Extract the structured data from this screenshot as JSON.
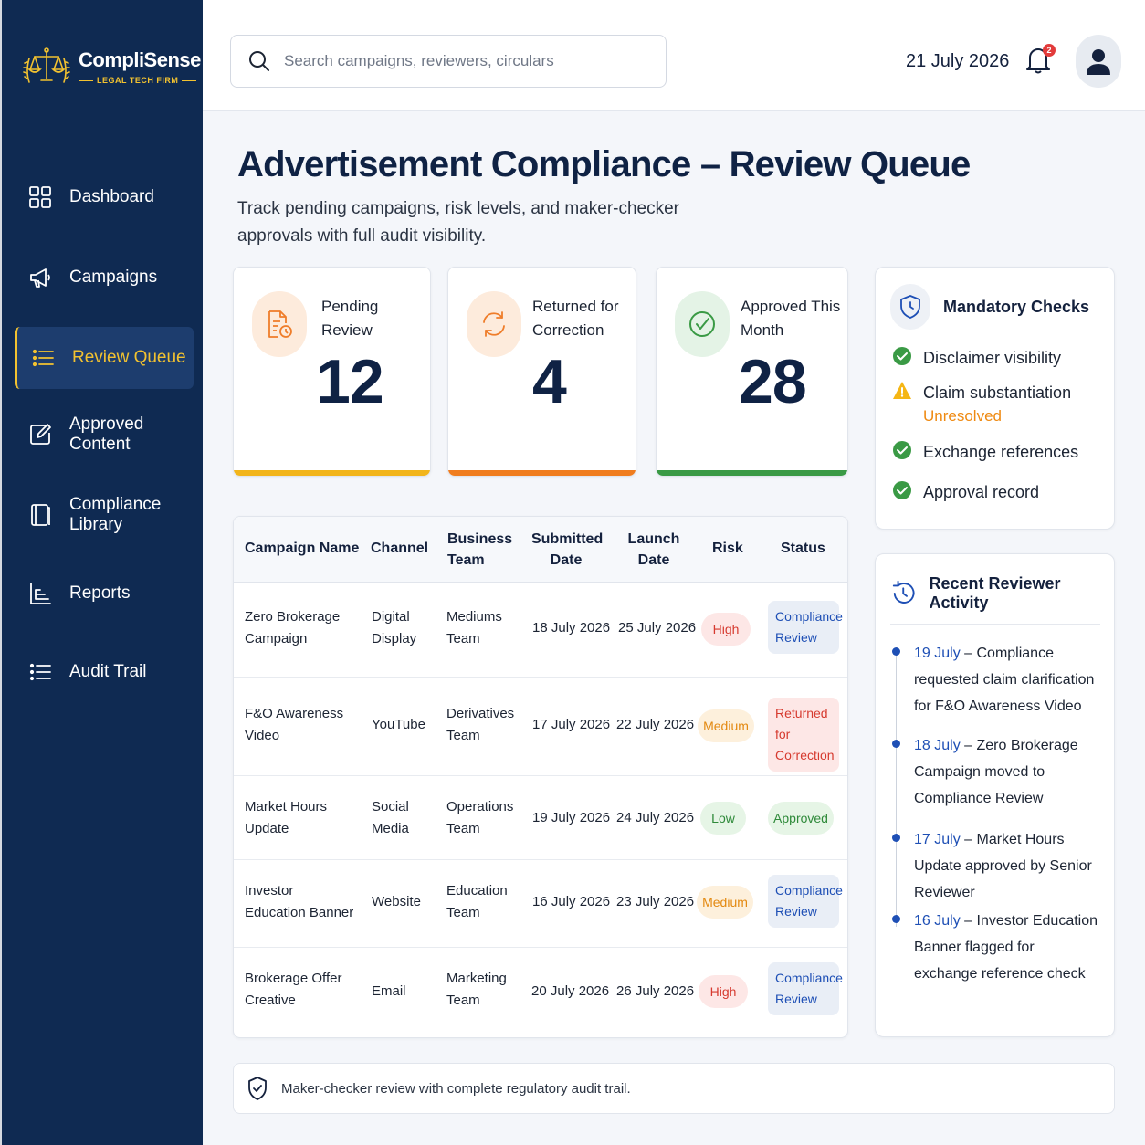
{
  "brand": {
    "name": "CompliSense",
    "tagline": "LEGAL TECH FIRM"
  },
  "sidebar": {
    "items": [
      {
        "label": "Dashboard",
        "icon": "grid-icon",
        "active": false
      },
      {
        "label": "Campaigns",
        "icon": "megaphone-icon",
        "active": false
      },
      {
        "label": "Review Queue",
        "icon": "list-icon",
        "active": true
      },
      {
        "label": "Approved Content",
        "icon": "edit-icon",
        "active": false
      },
      {
        "label": "Compliance Library",
        "icon": "book-icon",
        "active": false
      },
      {
        "label": "Reports",
        "icon": "bar-chart-icon",
        "active": false
      },
      {
        "label": "Audit Trail",
        "icon": "list-icon",
        "active": false
      }
    ]
  },
  "topbar": {
    "search_placeholder": "Search campaigns, reviewers, circulars",
    "date": "21 July 2026",
    "notification_count": "2"
  },
  "page": {
    "title": "Advertisement Compliance – Review Queue",
    "subtitle": "Track pending campaigns, risk levels, and maker-checker approvals with full audit visibility."
  },
  "stats": [
    {
      "label": "Pending Review",
      "value": "12",
      "color": "#f2b51b",
      "icon": "document-clock-icon"
    },
    {
      "label": "Returned for Correction",
      "value": "4",
      "color": "#f07d1e",
      "icon": "refresh-icon"
    },
    {
      "label": "Approved This Month",
      "value": "28",
      "color": "#3a9a45",
      "icon": "check-circle-icon"
    }
  ],
  "checks": {
    "title": "Mandatory Checks",
    "items": [
      {
        "label": "Disclaimer visibility",
        "state": "ok"
      },
      {
        "label": "Claim substantiation",
        "state": "warning",
        "note": "Unresolved"
      },
      {
        "label": "Exchange references",
        "state": "ok"
      },
      {
        "label": "Approval record",
        "state": "ok"
      }
    ]
  },
  "table": {
    "headers": [
      "Campaign Name",
      "Channel",
      "Business Team",
      "Submitted Date",
      "Launch Date",
      "Risk",
      "Status"
    ],
    "rows": [
      {
        "campaign": "Zero Brokerage Campaign",
        "channel": "Digital Display",
        "team": "Mediums Team",
        "submitted": "18 July 2026",
        "launch": "25 July 2026",
        "risk": "High",
        "status": "Compliance Review"
      },
      {
        "campaign": "F&O Awareness Video",
        "channel": "YouTube",
        "team": "Derivatives Team",
        "submitted": "17 July 2026",
        "launch": "22 July 2026",
        "risk": "Medium",
        "status": "Returned for Correction"
      },
      {
        "campaign": "Market Hours Update",
        "channel": "Social Media",
        "team": "Operations Team",
        "submitted": "19 July 2026",
        "launch": "24 July 2026",
        "risk": "Low",
        "status": "Approved"
      },
      {
        "campaign": "Investor Education Banner",
        "channel": "Website",
        "team": "Education Team",
        "submitted": "16 July 2026",
        "launch": "23 July 2026",
        "risk": "Medium",
        "status": "Compliance Review"
      },
      {
        "campaign": "Brokerage Offer Creative",
        "channel": "Email",
        "team": "Marketing Team",
        "submitted": "20 July 2026",
        "launch": "26 July 2026",
        "risk": "High",
        "status": "Compliance Review"
      }
    ]
  },
  "activity": {
    "title": "Recent Reviewer Activity",
    "items": [
      {
        "date": "19 July",
        "text": " – Compliance requested claim clarification for F&O Awareness Video"
      },
      {
        "date": "18 July",
        "text": " – Zero Brokerage Campaign moved to Compliance Review"
      },
      {
        "date": "17 July",
        "text": " – Market Hours Update approved by Senior Reviewer"
      },
      {
        "date": "16 July",
        "text": " – Investor Education Banner flagged for exchange reference check"
      }
    ]
  },
  "footer": {
    "text": "Maker-checker review with complete regulatory audit trail."
  }
}
